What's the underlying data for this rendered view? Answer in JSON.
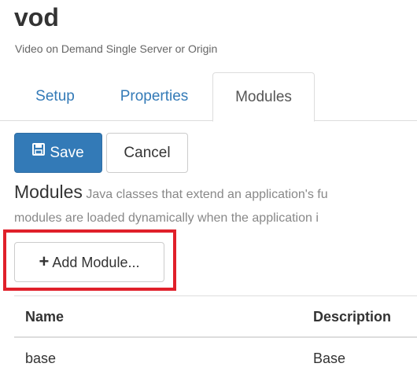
{
  "header": {
    "title": "vod",
    "subtitle": "Video on Demand Single Server or Origin"
  },
  "tabs": [
    {
      "label": "Setup",
      "active": false
    },
    {
      "label": "Properties",
      "active": false
    },
    {
      "label": "Modules",
      "active": true
    }
  ],
  "toolbar": {
    "save_label": "Save",
    "cancel_label": "Cancel"
  },
  "modules_section": {
    "heading": "Modules",
    "description_line1": "Java classes that extend an application's fu",
    "description_line2": "modules are loaded dynamically when the application i",
    "add_button_label": "Add Module..."
  },
  "table": {
    "columns": [
      "Name",
      "Description"
    ],
    "rows": [
      {
        "name": "base",
        "description": "Base"
      }
    ]
  },
  "colors": {
    "primary": "#337ab7",
    "highlight": "#e0202a"
  },
  "icons": {
    "save": "floppy-disk-icon",
    "add": "plus-icon"
  }
}
